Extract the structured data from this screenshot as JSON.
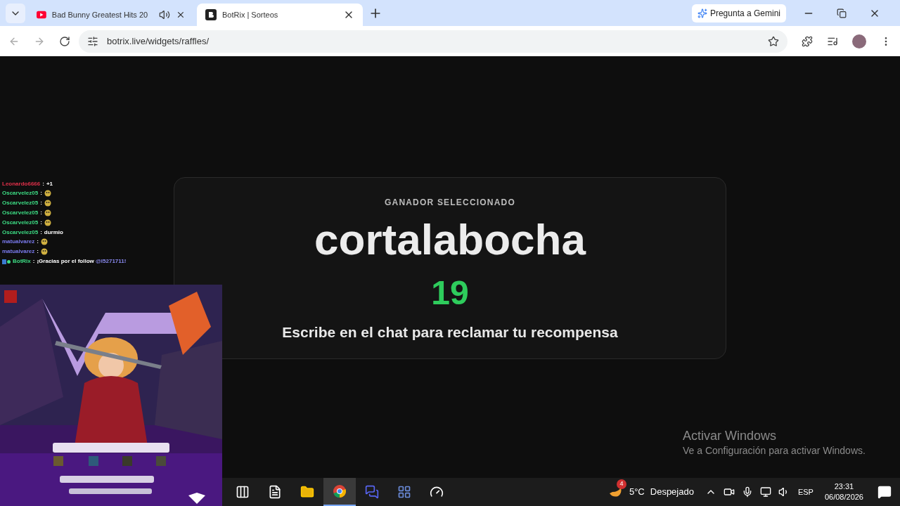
{
  "browser": {
    "tabs": [
      {
        "title": "Bad Bunny Greatest Hits 20",
        "selected": false,
        "kind": "video",
        "audio": true
      },
      {
        "title": "BotRix | Sorteos",
        "selected": true,
        "kind": "site",
        "audio": false
      }
    ],
    "gemini_button": "Pregunta a Gemini",
    "url": "botrix.live/widgets/raffles/"
  },
  "winner": {
    "heading": "GANADOR SELECCIONADO",
    "name": "cortalabocha",
    "countdown": "19",
    "instruction": "Escribe en el chat para reclamar tu recompensa"
  },
  "chat": [
    {
      "user": "Leonardo6666",
      "color": "#e0304a",
      "separator": ":",
      "kind": "text",
      "message": "+1"
    },
    {
      "user": "Oscarvelez05",
      "color": "#3ddc84",
      "separator": ":",
      "kind": "emote"
    },
    {
      "user": "Oscarvelez05",
      "color": "#3ddc84",
      "separator": ":",
      "kind": "emote"
    },
    {
      "user": "Oscarvelez05",
      "color": "#3ddc84",
      "separator": ":",
      "kind": "emote"
    },
    {
      "user": "Oscarvelez05",
      "color": "#3ddc84",
      "separator": ":",
      "kind": "emote"
    },
    {
      "user": "Oscarvelez05",
      "color": "#3ddc84",
      "separator": ":",
      "kind": "text",
      "message": "durmio"
    },
    {
      "user": "matualvarez",
      "color": "#7b7bf0",
      "separator": ":",
      "kind": "emote"
    },
    {
      "user": "matualvarez",
      "color": "#7b7bf0",
      "separator": ":",
      "kind": "emote"
    },
    {
      "user": "BotRix",
      "color": "#3ddc84",
      "separator": ":",
      "kind": "bot",
      "message": "¡Gracias por el follow",
      "mention": "@l5271711!"
    }
  ],
  "taskbar": {
    "apps": [
      {
        "kind": "taskview",
        "selected": false
      },
      {
        "kind": "file",
        "selected": false
      },
      {
        "kind": "folder",
        "selected": false
      },
      {
        "kind": "chrome",
        "selected": true
      },
      {
        "kind": "chat",
        "selected": false
      },
      {
        "kind": "grid",
        "selected": false
      },
      {
        "kind": "gauge",
        "selected": false
      }
    ],
    "weather": {
      "badge": "4",
      "temperature": "5°C",
      "condition": "Despejado"
    },
    "language": "ESP",
    "time": "23:31",
    "date": "06/08/2026"
  },
  "activation": {
    "title": "Activar Windows",
    "subtitle": "Ve a Configuración para activar Windows."
  }
}
